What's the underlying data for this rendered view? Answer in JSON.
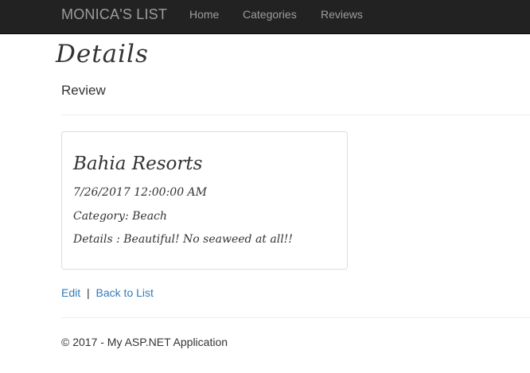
{
  "navbar": {
    "brand": "MONICA'S LIST",
    "links": [
      {
        "label": "Home"
      },
      {
        "label": "Categories"
      },
      {
        "label": "Reviews"
      }
    ],
    "background": "#222222",
    "link_color": "#9d9d9d"
  },
  "page": {
    "heading": "Details",
    "subheading": "Review"
  },
  "review": {
    "title": "Bahia Resorts",
    "date": "7/26/2017 12:00:00 AM",
    "category": "Category: Beach",
    "details": "Details : Beautiful! No seaweed at all!!"
  },
  "actions": {
    "edit_label": "Edit",
    "separator": "|",
    "back_label": "Back to List",
    "link_color": "#337ab7"
  },
  "footer": {
    "text": "© 2017 - My ASP.NET Application"
  }
}
